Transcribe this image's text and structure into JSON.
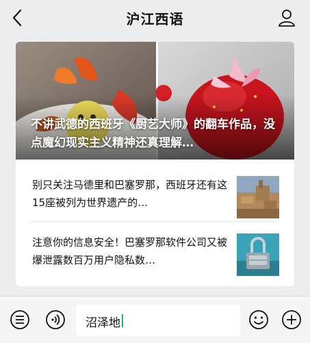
{
  "navbar": {
    "title": "沪江西语"
  },
  "card": {
    "hero_title": "不讲武德的西班牙《厨艺大师》的翻车作品，没点魔幻现实主义精神还真理解…",
    "items": [
      {
        "title": "别只关注马德里和巴塞罗那，西班牙还有这15座被列为世界遗产的…",
        "thumb": "city-thumbnail"
      },
      {
        "title": "注意你的信息安全！巴塞罗那软件公司又被爆泄露数百万用户隐私数…",
        "thumb": "padlock-thumbnail"
      }
    ]
  },
  "bottombar": {
    "input_value": "沼泽地",
    "icons": [
      "menu-icon",
      "voice-icon",
      "emoji-icon",
      "plus-icon"
    ]
  },
  "colors": {
    "accent": "#07c160",
    "background": "#ededed"
  }
}
